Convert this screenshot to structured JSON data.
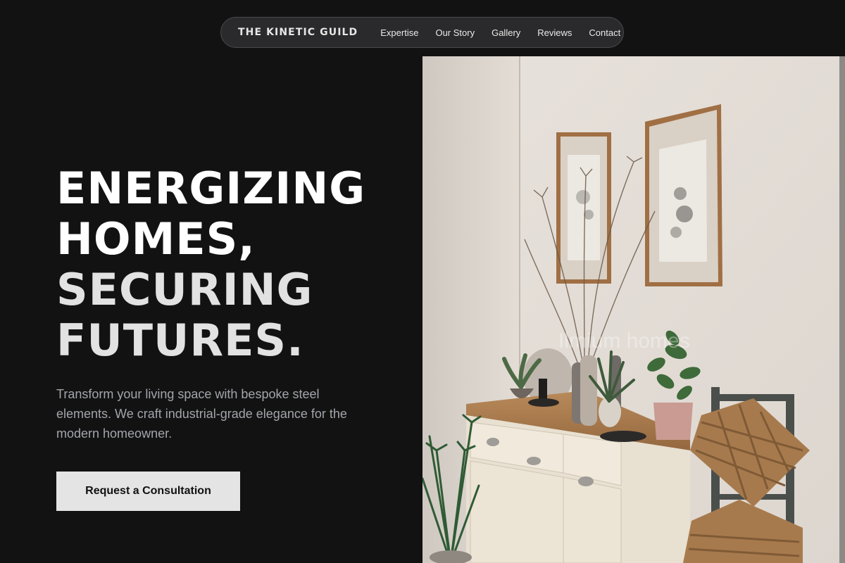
{
  "nav": {
    "brand": "THE KINETIC GUILD",
    "links": [
      "Expertise",
      "Our Story",
      "Gallery",
      "Reviews",
      "Contact"
    ]
  },
  "hero": {
    "headline_lines": [
      "ENERGIZING",
      "HOMES,",
      "SECURING",
      "FUTURES."
    ],
    "subcopy": "Transform your living space with bespoke steel elements. We craft industrial-grade elegance for the modern homeowner.",
    "cta_label": "Request a Consultation"
  },
  "photo": {
    "watermark": "Ilmium homes"
  },
  "colors": {
    "background": "#121213",
    "nav_background": "#2a2a2c",
    "headline_primary": "#ffffff",
    "headline_secondary": "#e2e2e2",
    "subcopy": "#a3a5aa",
    "cta_background": "#e4e4e4",
    "cta_text": "#111111"
  }
}
